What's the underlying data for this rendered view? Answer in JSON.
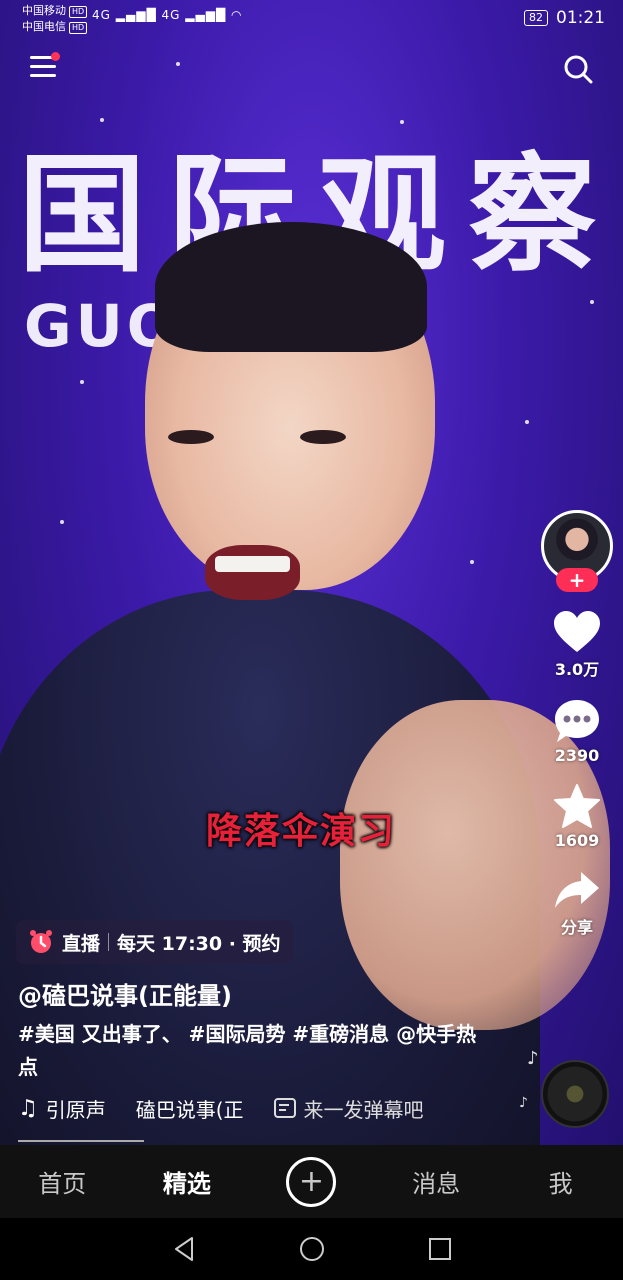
{
  "status_bar": {
    "carrier1": "中国移动",
    "carrier2": "中国电信",
    "hd_label": "HD",
    "network": "4G",
    "battery": "82",
    "time": "01:21"
  },
  "video": {
    "background_title": "国际观察",
    "background_subtitle": "GUO        N CHA",
    "caption": "降落伞演习"
  },
  "sidebar": {
    "follow_label": "+",
    "likes": "3.0万",
    "comments": "2390",
    "favorites": "1609",
    "share_label": "分享"
  },
  "info": {
    "live_label": "直播",
    "live_schedule": "每天 17:30 · 预约",
    "author": "@磕巴说事(正能量)",
    "description": "#美国 又出事了、 #国际局势 #重磅消息 @快手热点",
    "music": "引原声",
    "music_author": "磕巴说事(正",
    "danmaku_placeholder": "来一发弹幕吧"
  },
  "tabs": {
    "home": "首页",
    "featured": "精选",
    "plus": "+",
    "messages": "消息",
    "me": "我"
  },
  "colors": {
    "accent": "#ff2e56",
    "caption_red": "#e8213a",
    "tabbar_bg": "#111111"
  }
}
